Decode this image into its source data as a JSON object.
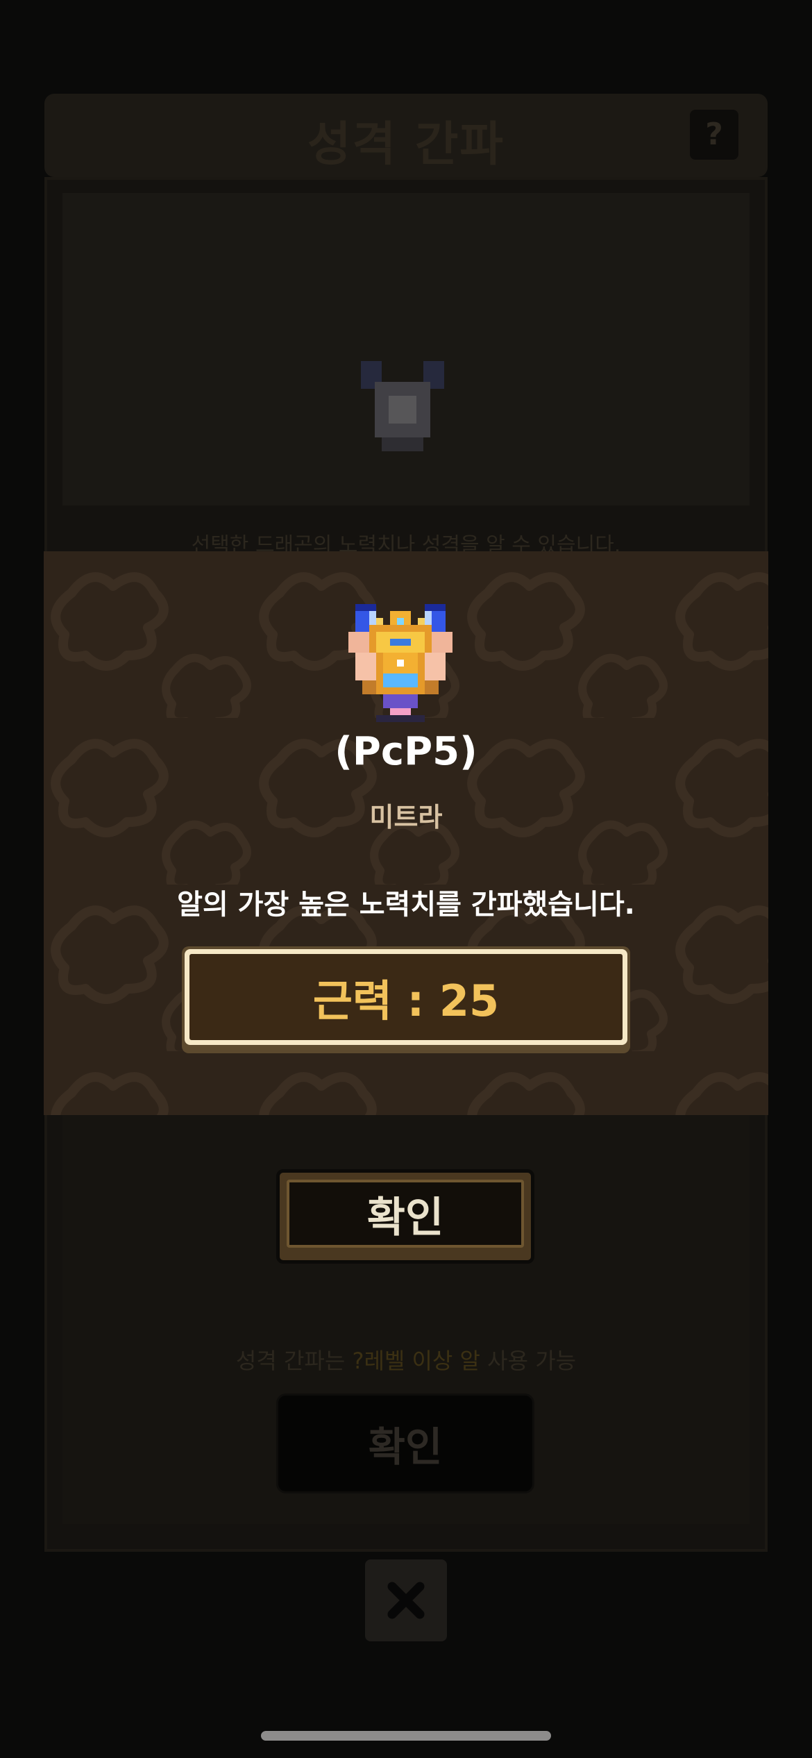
{
  "background": {
    "title": "성격 간파",
    "help_label": "?",
    "description": "선택한 드래곤의 노력치나 성격을 알 수 있습니다.",
    "confirm_label": "확인",
    "usage_prefix": "성격 간파는",
    "usage_highlight": "?레벨 이상 알",
    "usage_suffix": "사용 가능",
    "confirm2_label": "확인"
  },
  "result": {
    "dragon_code": "(PcP5)",
    "dragon_name": "미트라",
    "message": "알의 가장 높은 노력치를 간파했습니다.",
    "stat": "근력 : 25"
  },
  "icons": [
    "help-icon",
    "dragon-sprite",
    "close-icon"
  ],
  "colors": {
    "overlay_bg": "#2f241a",
    "stat_text": "#f2c25b",
    "stat_frame": "#f6e8c6",
    "dragon_name": "#d8c2a2"
  }
}
